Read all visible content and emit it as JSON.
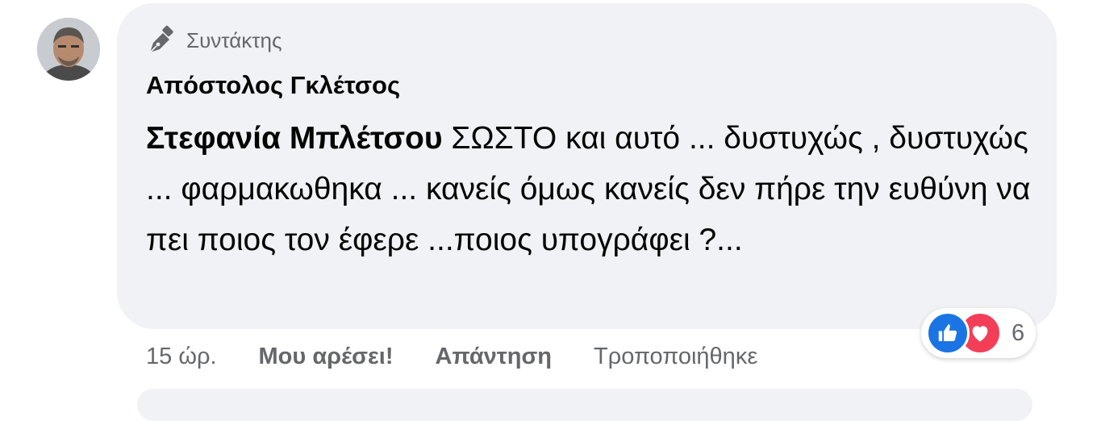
{
  "comment": {
    "badge_icon": "pen-nib-icon",
    "badge_label": "Συντάκτης",
    "author": "Απόστολος Γκλέτσος",
    "mention": "Στεφανία Μπλέτσου",
    "text": " ΣΩΣΤΟ και αυτό ... δυστυχώς , δυστυχώς ... φαρμακωθηκα ... κανείς όμως κανείς δεν πήρε την ευθύνη να πει ποιος τον έφερε ...ποιος υπογράφει ?...",
    "bubble_color": "#f0f2f5"
  },
  "actions": {
    "time": "15 ώρ.",
    "like_label": "Μου αρέσει!",
    "reply_label": "Απάντηση",
    "edited_label": "Τροποποιήθηκε"
  },
  "reactions": {
    "icons": [
      "like-reaction-icon",
      "love-reaction-icon"
    ],
    "count": "6",
    "like_color": "#1b74e4",
    "love_color": "#f33e58"
  }
}
